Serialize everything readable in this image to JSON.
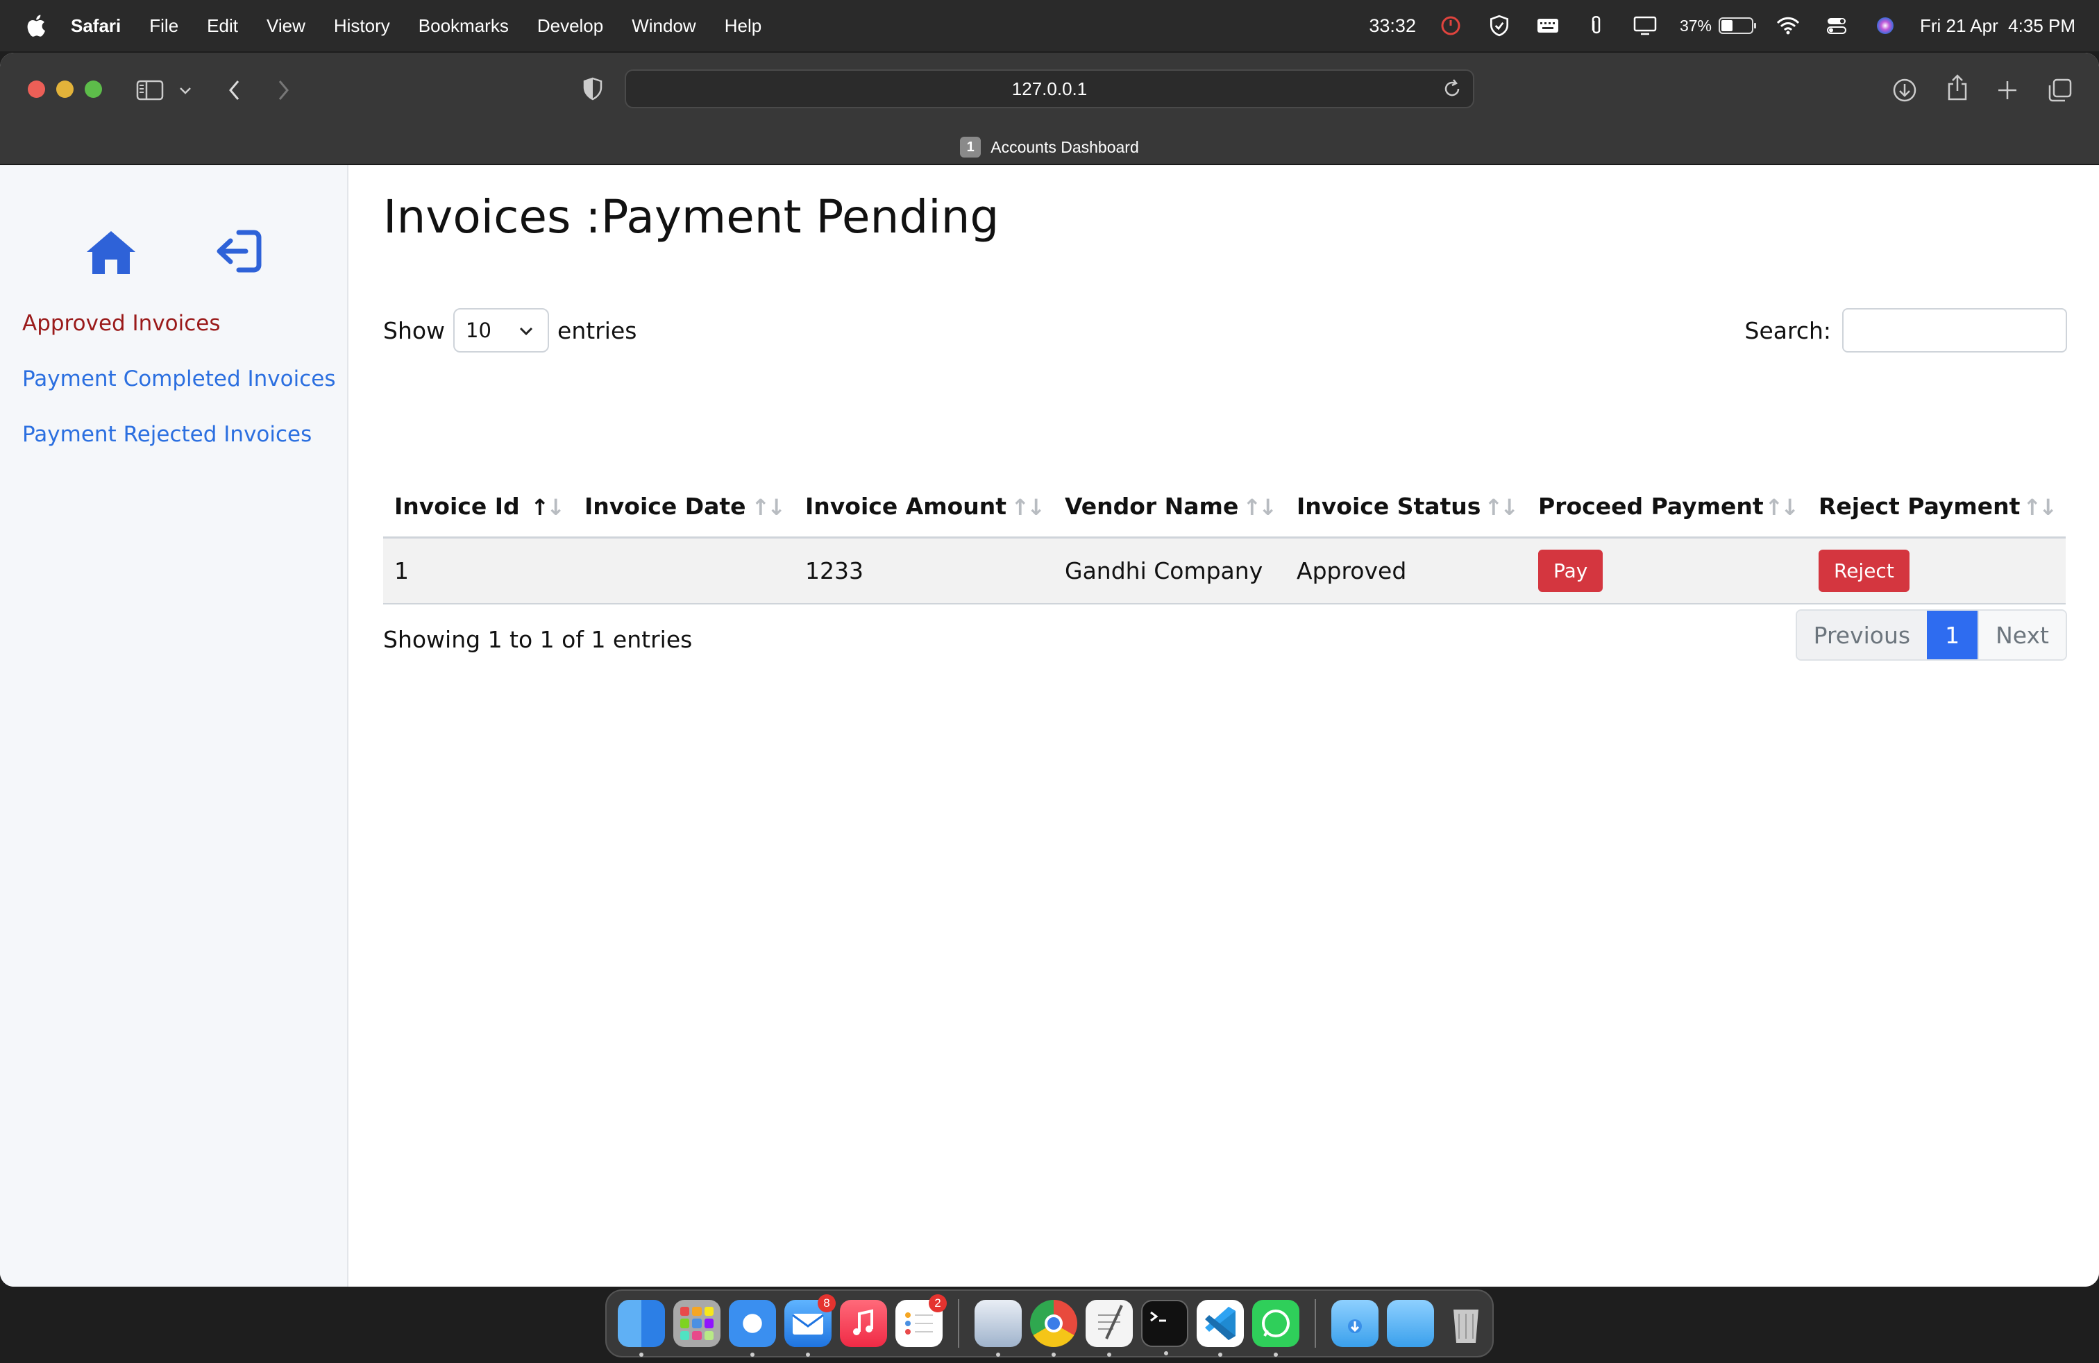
{
  "menubar": {
    "app_name": "Safari",
    "menus": [
      "File",
      "Edit",
      "View",
      "History",
      "Bookmarks",
      "Develop",
      "Window",
      "Help"
    ],
    "timer": "33:32",
    "battery_percent": "37%",
    "datetime": "Fri 21 Apr  4:35 PM"
  },
  "browser": {
    "url": "127.0.0.1",
    "tab_count": "1",
    "tab_title": "Accounts Dashboard"
  },
  "sidebar": {
    "icons": [
      "home-icon",
      "logout-icon"
    ],
    "links": [
      {
        "label": "Approved Invoices",
        "active": true
      },
      {
        "label": "Payment Completed Invoices",
        "active": false
      },
      {
        "label": "Payment Rejected Invoices",
        "active": false
      }
    ]
  },
  "main": {
    "title": "Invoices :Payment Pending",
    "show_label": "Show",
    "entries_value": "10",
    "entries_label": "entries",
    "search_label": "Search:",
    "search_value": "",
    "columns": [
      "Invoice Id",
      "Invoice Date",
      "Invoice Amount",
      "Vendor Name",
      "Invoice Status",
      "Proceed Payment",
      "Reject Payment"
    ],
    "rows": [
      {
        "id": "1",
        "date": "",
        "amount": "1233",
        "vendor": "Gandhi Company",
        "status": "Approved",
        "pay_label": "Pay",
        "reject_label": "Reject"
      }
    ],
    "info_text": "Showing 1 to 1 of 1 entries",
    "pagination": {
      "previous": "Previous",
      "current": "1",
      "next": "Next"
    }
  },
  "dock": {
    "badges": {
      "mail": "8",
      "reminders": "2"
    }
  },
  "colors": {
    "accent": "#2b6fe0",
    "active_link": "#9a1a1a",
    "danger": "#d4363f",
    "page_current": "#2e6cf0"
  }
}
